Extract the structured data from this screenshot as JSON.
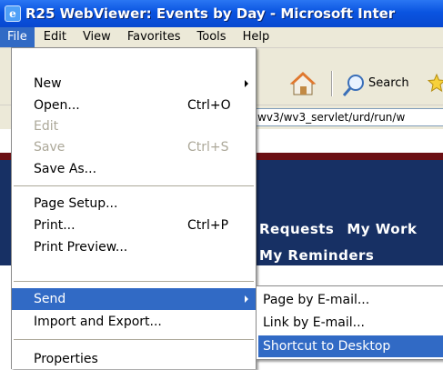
{
  "window": {
    "title": "R25 WebViewer: Events by Day - Microsoft Inter",
    "logo_icon": "ie-logo-icon"
  },
  "menubar": {
    "items": [
      "File",
      "Edit",
      "View",
      "Favorites",
      "Tools",
      "Help"
    ],
    "active": "File"
  },
  "toolbar": {
    "search_label": "Search"
  },
  "address": {
    "value": "wv3/wv3_servlet/urd/run/w"
  },
  "page": {
    "nav_requests": "Requests",
    "nav_mywork": "My Work",
    "nav_reminders": "My Reminders",
    "colors": {
      "navy": "#173064",
      "maroon": "#6b0f14"
    }
  },
  "file_menu": {
    "items": [
      {
        "label": "New",
        "shortcut": "",
        "submenu": true,
        "disabled": false
      },
      {
        "label": "Open...",
        "shortcut": "Ctrl+O",
        "submenu": false,
        "disabled": false
      },
      {
        "label": "Edit",
        "shortcut": "",
        "submenu": false,
        "disabled": true
      },
      {
        "label": "Save",
        "shortcut": "Ctrl+S",
        "submenu": false,
        "disabled": true
      },
      {
        "label": "Save As...",
        "shortcut": "",
        "submenu": false,
        "disabled": false
      },
      {
        "label": "Page Setup...",
        "shortcut": "",
        "submenu": false,
        "disabled": false
      },
      {
        "label": "Print...",
        "shortcut": "Ctrl+P",
        "submenu": false,
        "disabled": false
      },
      {
        "label": "Print Preview...",
        "shortcut": "",
        "submenu": false,
        "disabled": false
      },
      {
        "label": "Send",
        "shortcut": "",
        "submenu": true,
        "disabled": false,
        "highlighted": true
      },
      {
        "label": "Import and Export...",
        "shortcut": "",
        "submenu": false,
        "disabled": false
      },
      {
        "label": "Properties",
        "shortcut": "",
        "submenu": false,
        "disabled": false
      }
    ]
  },
  "send_menu": {
    "items": [
      {
        "label": "Page by E-mail..."
      },
      {
        "label": "Link by E-mail..."
      },
      {
        "label": "Shortcut to Desktop",
        "highlighted": true
      }
    ]
  },
  "accent_color": "#316ac5"
}
